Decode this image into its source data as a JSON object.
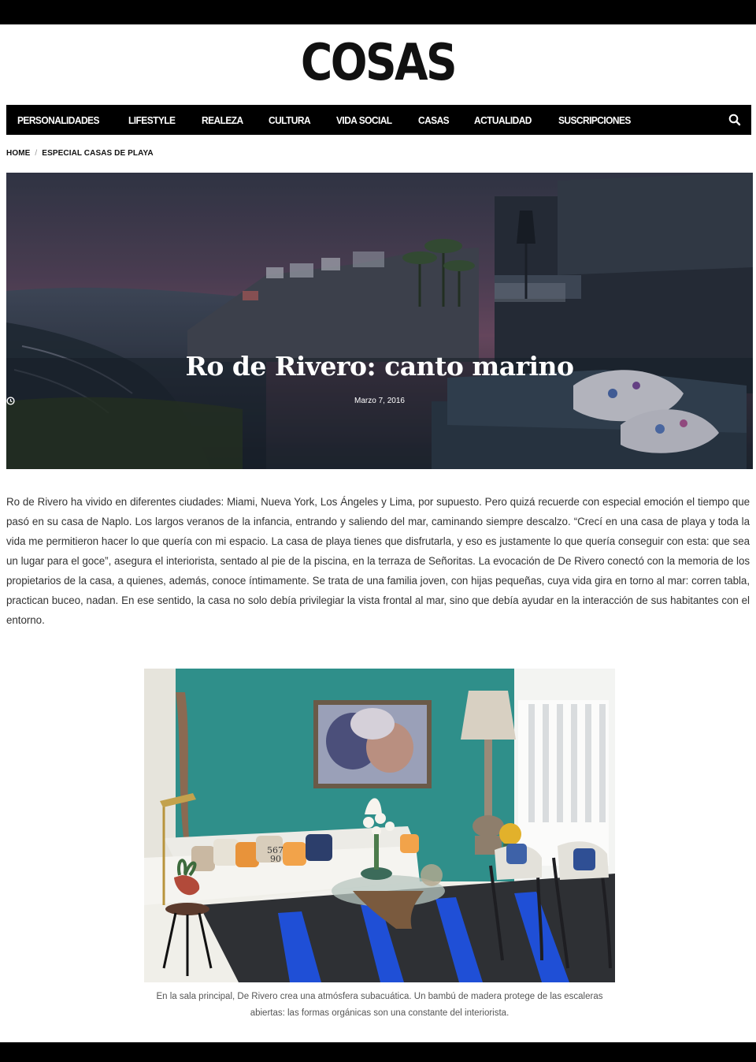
{
  "site": {
    "logo": "COSAS"
  },
  "nav": {
    "items": [
      {
        "label": "PERSONALIDADES"
      },
      {
        "label": "LIFESTYLE"
      },
      {
        "label": "REALEZA"
      },
      {
        "label": "CULTURA"
      },
      {
        "label": "VIDA SOCIAL"
      },
      {
        "label": "CASAS"
      },
      {
        "label": "ACTUALIDAD"
      },
      {
        "label": "SUSCRIPCIONES"
      }
    ],
    "search_icon": "search-icon"
  },
  "breadcrumb": {
    "home": "HOME",
    "separator": "/",
    "current": "ESPECIAL CASAS DE PLAYA"
  },
  "hero": {
    "title": "Ro de Rivero: canto marino",
    "date": "Marzo 7, 2016",
    "date_icon": "clock-icon"
  },
  "article": {
    "body": "Ro de Rivero ha vivido en diferentes ciudades: Miami, Nueva York, Los Ángeles y Lima, por supuesto. Pero quizá recuerde con especial emoción el tiempo que pasó en su casa de Naplo. Los largos veranos de la infancia, entrando y saliendo del mar, caminando siempre descalzo. “Crecí en una casa de playa y toda la vida me permitieron hacer lo que quería con mi espacio. La casa de playa tienes que disfrutarla, y eso es justamente lo que quería conseguir con esta: que sea un lugar para el goce”, asegura el interiorista, sentado al pie de la piscina, en la terraza de Señoritas. La evocación de De Rivero conectó con la memoria de los propietarios de la casa, a quienes, además, conoce íntimamente. Se trata de una familia joven, con hijas pequeñas, cuya vida gira en torno al mar: corren tabla, practican buceo, nadan. En ese sentido, la casa no solo debía privilegiar la vista frontal al mar, sino que debía ayudar en la interacción de sus habitantes con el entorno."
  },
  "figure": {
    "caption": "En la sala principal, De Rivero crea una atmósfera subacuática. Un bambú de madera protege de las escaleras abiertas: las formas orgánicas son una constante del interiorista.",
    "cushion_text": "567\n90"
  },
  "colors": {
    "black": "#000000",
    "teal_wall": "#2f8f8a",
    "rug_blue": "#1f4fd6"
  }
}
